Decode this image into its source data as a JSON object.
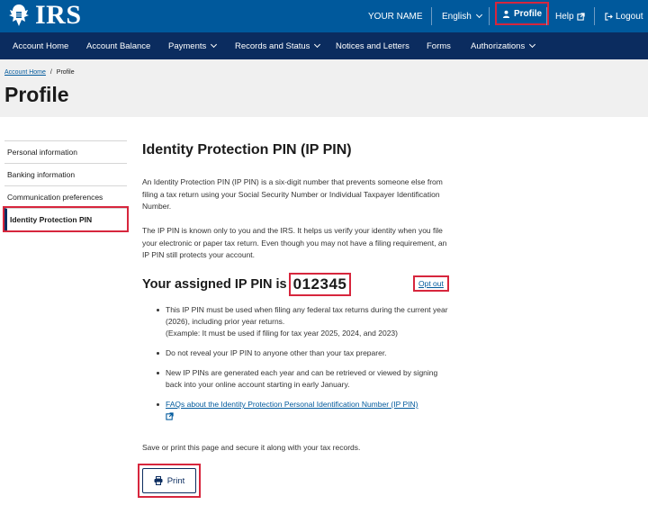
{
  "header": {
    "logo_text": "IRS",
    "user_name": "YOUR NAME",
    "language": "English",
    "profile_label": "Profile",
    "help_label": "Help",
    "logout_label": "Logout"
  },
  "nav": {
    "items": [
      {
        "label": "Account Home"
      },
      {
        "label": "Account Balance"
      },
      {
        "label": "Payments"
      },
      {
        "label": "Records and Status"
      },
      {
        "label": "Notices and Letters"
      },
      {
        "label": "Forms"
      },
      {
        "label": "Authorizations"
      }
    ]
  },
  "breadcrumb": {
    "home": "Account Home",
    "separator": "/",
    "current": "Profile"
  },
  "page_title": "Profile",
  "sidebar": {
    "items": [
      {
        "label": "Personal information"
      },
      {
        "label": "Banking information"
      },
      {
        "label": "Communication preferences"
      },
      {
        "label": "Identity Protection PIN"
      }
    ]
  },
  "main": {
    "heading": "Identity Protection PIN (IP PIN)",
    "para1": "An Identity Protection PIN (IP PIN) is a six-digit number that prevents someone else from filing a tax return using your Social Security Number or Individual Taxpayer Identification Number.",
    "para2": "The IP PIN is known only to you and the IRS. It helps us verify your identity when you file your electronic or paper tax return. Even though you may not have a filing requirement, an IP PIN still protects your account.",
    "pin_label": "Your assigned IP PIN is",
    "pin_value": "012345",
    "opt_out": "Opt out",
    "bullets": [
      {
        "line1": "This IP PIN must be used when filing any federal tax returns during the current year (2026), including prior year returns.",
        "line2": "(Example: It must be used if filing for tax year 2025, 2024, and 2023)"
      },
      {
        "line1": "Do not reveal your IP PIN to anyone other than your tax preparer."
      },
      {
        "line1": "New IP PINs are generated each year and can be retrieved or viewed by signing back into your online account starting in early January."
      }
    ],
    "faq_link": "FAQs about the Identity Protection Personal Identification Number (IP PIN)",
    "save_note": "Save or print this page and secure it along with your tax records.",
    "print_label": "Print"
  },
  "colors": {
    "topbar": "#00599c",
    "navbar": "#0b2c5f",
    "highlight": "#d7263d",
    "link": "#00599c"
  },
  "icons": {
    "logo": "irs-eagle-icon",
    "profile": "person-icon",
    "help": "external-link-icon",
    "logout": "logout-icon",
    "print": "printer-icon"
  }
}
